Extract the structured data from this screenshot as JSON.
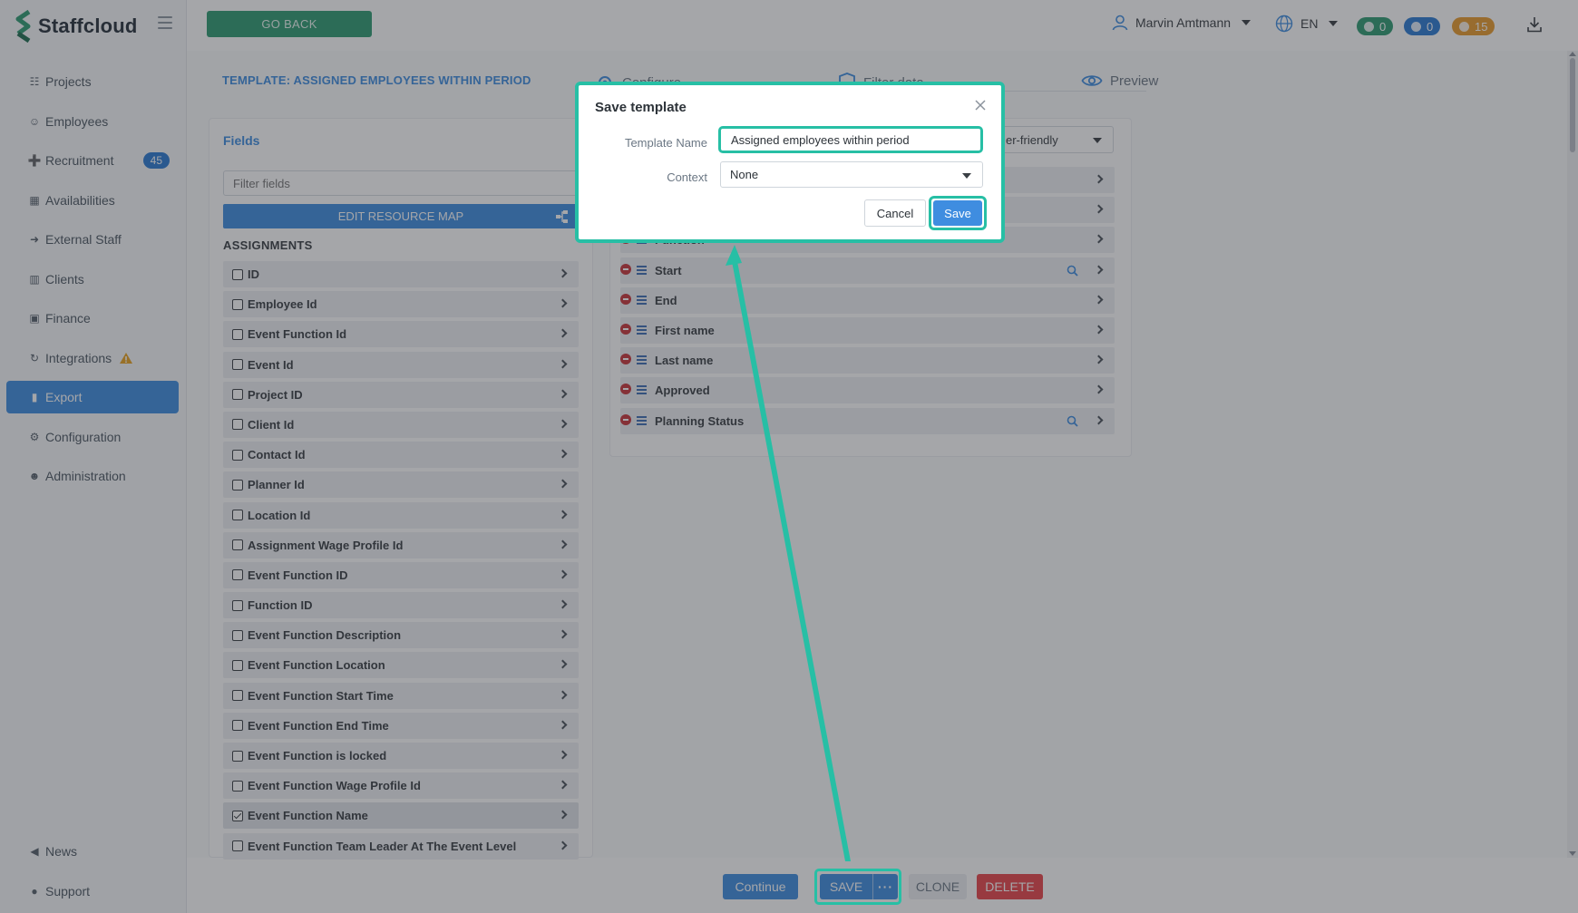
{
  "app": {
    "brand": "Staffcloud",
    "go_back": "GO BACK",
    "user_name": "Marvin Amtmann",
    "language": "EN",
    "badges": [
      {
        "value": "0",
        "color": "#2f9b73"
      },
      {
        "value": "0",
        "color": "#2b7bd3"
      },
      {
        "value": "15",
        "color": "#e89b2e"
      }
    ]
  },
  "sidebar": {
    "items": [
      {
        "label": "Projects",
        "icon": "sitemap-icon"
      },
      {
        "label": "Employees",
        "icon": "users-icon"
      },
      {
        "label": "Recruitment",
        "icon": "user-plus-icon",
        "badge": "45"
      },
      {
        "label": "Availabilities",
        "icon": "calendar-icon"
      },
      {
        "label": "External Staff",
        "icon": "sign-in-icon"
      },
      {
        "label": "Clients",
        "icon": "building-icon"
      },
      {
        "label": "Finance",
        "icon": "money-icon"
      },
      {
        "label": "Integrations",
        "icon": "sync-icon",
        "warning": true
      },
      {
        "label": "Export",
        "icon": "file-icon",
        "active": true
      },
      {
        "label": "Configuration",
        "icon": "gear-icon"
      },
      {
        "label": "Administration",
        "icon": "user-cog-icon"
      }
    ],
    "bottom": [
      {
        "label": "News",
        "icon": "megaphone-icon"
      },
      {
        "label": "Support",
        "icon": "comments-icon"
      }
    ]
  },
  "page": {
    "template_title": "TEMPLATE: ASSIGNED EMPLOYEES WITHIN PERIOD",
    "tabs": [
      {
        "label": "Configure",
        "icon": "gear-icon"
      },
      {
        "label": "Filter data",
        "icon": "shield-icon"
      },
      {
        "label": "Preview",
        "icon": "eye-icon"
      }
    ]
  },
  "fields": {
    "heading": "Fields",
    "filter_placeholder": "Filter fields",
    "edit_resource_map": "EDIT RESOURCE MAP",
    "group_label": "ASSIGNMENTS",
    "rows": [
      {
        "label": "ID",
        "checked": false
      },
      {
        "label": "Employee Id",
        "checked": false
      },
      {
        "label": "Event Function Id",
        "checked": false
      },
      {
        "label": "Event Id",
        "checked": false
      },
      {
        "label": "Project ID",
        "checked": false
      },
      {
        "label": "Client Id",
        "checked": false
      },
      {
        "label": "Contact Id",
        "checked": false
      },
      {
        "label": "Planner Id",
        "checked": false
      },
      {
        "label": "Location Id",
        "checked": false
      },
      {
        "label": "Assignment Wage Profile Id",
        "checked": false
      },
      {
        "label": "Event Function ID",
        "checked": false
      },
      {
        "label": "Function ID",
        "checked": false
      },
      {
        "label": "Event Function Description",
        "checked": false
      },
      {
        "label": "Event Function Location",
        "checked": false
      },
      {
        "label": "Event Function Start Time",
        "checked": false
      },
      {
        "label": "Event Function End Time",
        "checked": false
      },
      {
        "label": "Event Function is locked",
        "checked": false
      },
      {
        "label": "Event Function Wage Profile Id",
        "checked": false
      },
      {
        "label": "Event Function Name",
        "checked": true
      },
      {
        "label": "Event Function Team Leader At The Event Level",
        "checked": false
      }
    ]
  },
  "selected": {
    "format_value": "er-friendly",
    "rows": [
      {
        "label": "",
        "search": false,
        "hidden_controls": true
      },
      {
        "label": "",
        "search": false,
        "hidden_controls": true
      },
      {
        "label": "Function",
        "search": false
      },
      {
        "label": "Start",
        "search": true
      },
      {
        "label": "End",
        "search": false
      },
      {
        "label": "First name",
        "search": false
      },
      {
        "label": "Last name",
        "search": false
      },
      {
        "label": "Approved",
        "search": false
      },
      {
        "label": "Planning Status",
        "search": true
      }
    ]
  },
  "footer": {
    "continue": "Continue",
    "save": "SAVE",
    "more": "···",
    "clone": "CLONE",
    "delete": "DELETE"
  },
  "modal": {
    "title": "Save template",
    "name_label": "Template Name",
    "name_value": "Assigned employees within period",
    "context_label": "Context",
    "context_value": "None",
    "cancel": "Cancel",
    "save": "Save"
  },
  "colors": {
    "highlight": "#27bfa5",
    "primary": "#3f8de0",
    "danger": "#e8464b",
    "success": "#2f9b73"
  }
}
